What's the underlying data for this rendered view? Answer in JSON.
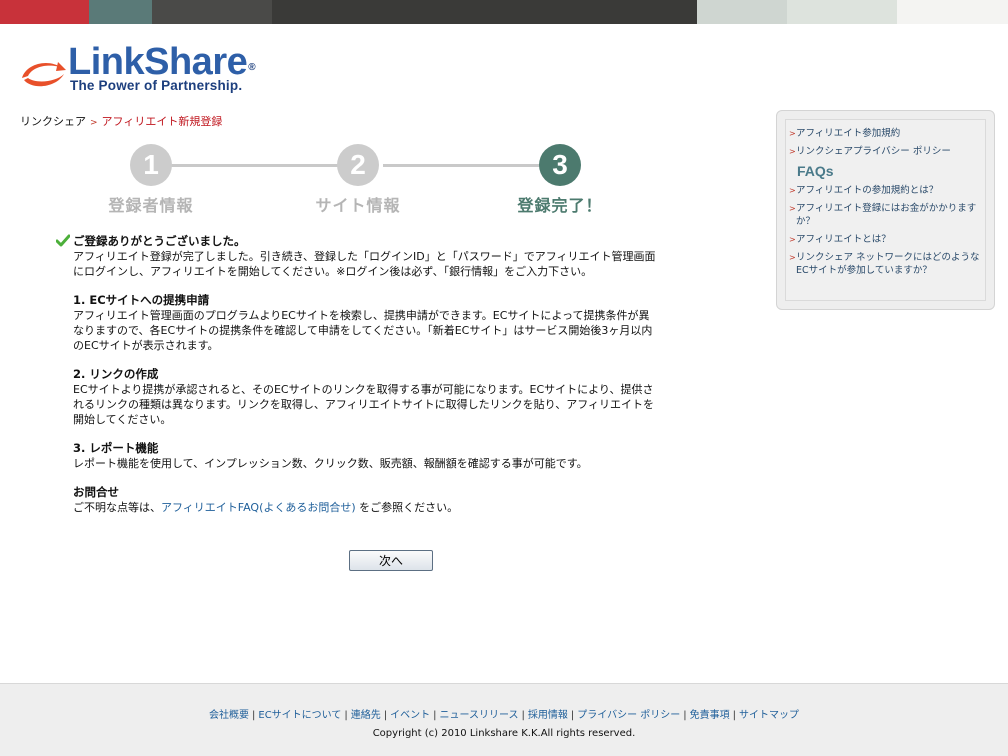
{
  "colors": {
    "brand_blue": "#2e5fa8",
    "brand_navy": "#1d3f7e",
    "brand_orange": "#e8502a",
    "step_inactive": "#cccccc",
    "step_inactive_label": "#b5b5b5",
    "step_active": "#4c7a6e",
    "step_active_label": "#4c7a6e",
    "breadcrumb_current": "#c0161e",
    "topband": [
      "#c8323a",
      "#5a7a78",
      "#4a4a48",
      "#3a3a38",
      "#cfd6d1",
      "#dde3dd",
      "#f4f4f2"
    ]
  },
  "logo": {
    "word_part1": "Link",
    "word_part2": "Share",
    "registered": "®",
    "tagline": "The Power of Partnership."
  },
  "breadcrumb": {
    "home": "リンクシェア",
    "current": "アフィリエイト新規登録"
  },
  "steps": [
    {
      "number": "1",
      "label": "登録者情報",
      "state": "done"
    },
    {
      "number": "2",
      "label": "サイト情報",
      "state": "done"
    },
    {
      "number": "3",
      "label": "登録完了！",
      "state": "active"
    }
  ],
  "main": {
    "thanks_title": "ご登録ありがとうございました。",
    "thanks_body": "アフィリエイト登録が完了しました。引き続き、登録した「ログインID」と「パスワード」でアフィリエイト管理画面にログインし、アフィリエイトを開始してください。※ログイン後は必ず、「銀行情報」をご入力下さい。",
    "sections": [
      {
        "title": "1. ECサイトへの提携申請",
        "body": "アフィリエイト管理画面のプログラムよりECサイトを検索し、提携申請ができます。ECサイトによって提携条件が異なりますので、各ECサイトの提携条件を確認して申請をしてください。「新着ECサイト」はサービス開始後3ヶ月以内のECサイトが表示されます。"
      },
      {
        "title": "2. リンクの作成",
        "body": "ECサイトより提携が承認されると、そのECサイトのリンクを取得する事が可能になります。ECサイトにより、提供されるリンクの種類は異なります。リンクを取得し、アフィリエイトサイトに取得したリンクを貼り、アフィリエイトを開始してください。"
      },
      {
        "title": "3. レポート機能",
        "body": "レポート機能を使用して、インプレッション数、クリック数、販売額、報酬額を確認する事が可能です。"
      }
    ],
    "contact": {
      "title": "お問合せ",
      "prefix": "ご不明な点等は、",
      "link": "アフィリエイトFAQ(よくあるお問合せ)",
      "suffix": " をご参照ください。"
    },
    "next_button": "次へ"
  },
  "sidebar": {
    "links_top": [
      "アフィリエイト参加規約",
      "リンクシェアプライバシー ポリシー"
    ],
    "faqs_heading": "FAQs",
    "faq_links": [
      "アフィリエイトの参加規約とは？",
      "アフィリエイト登録にはお金がかかりますか？",
      "アフィリエイトとは？",
      "リンクシェア ネットワークにはどのようなECサイトが参加していますか？"
    ]
  },
  "footer": {
    "links": [
      "会社概要",
      "ECサイトについて",
      "連絡先",
      "イベント",
      "ニュースリリース",
      "採用情報",
      "プライバシー ポリシー",
      "免責事項",
      "サイトマップ"
    ],
    "copyright": "Copyright (c) 2010 Linkshare K.K.All rights reserved."
  }
}
